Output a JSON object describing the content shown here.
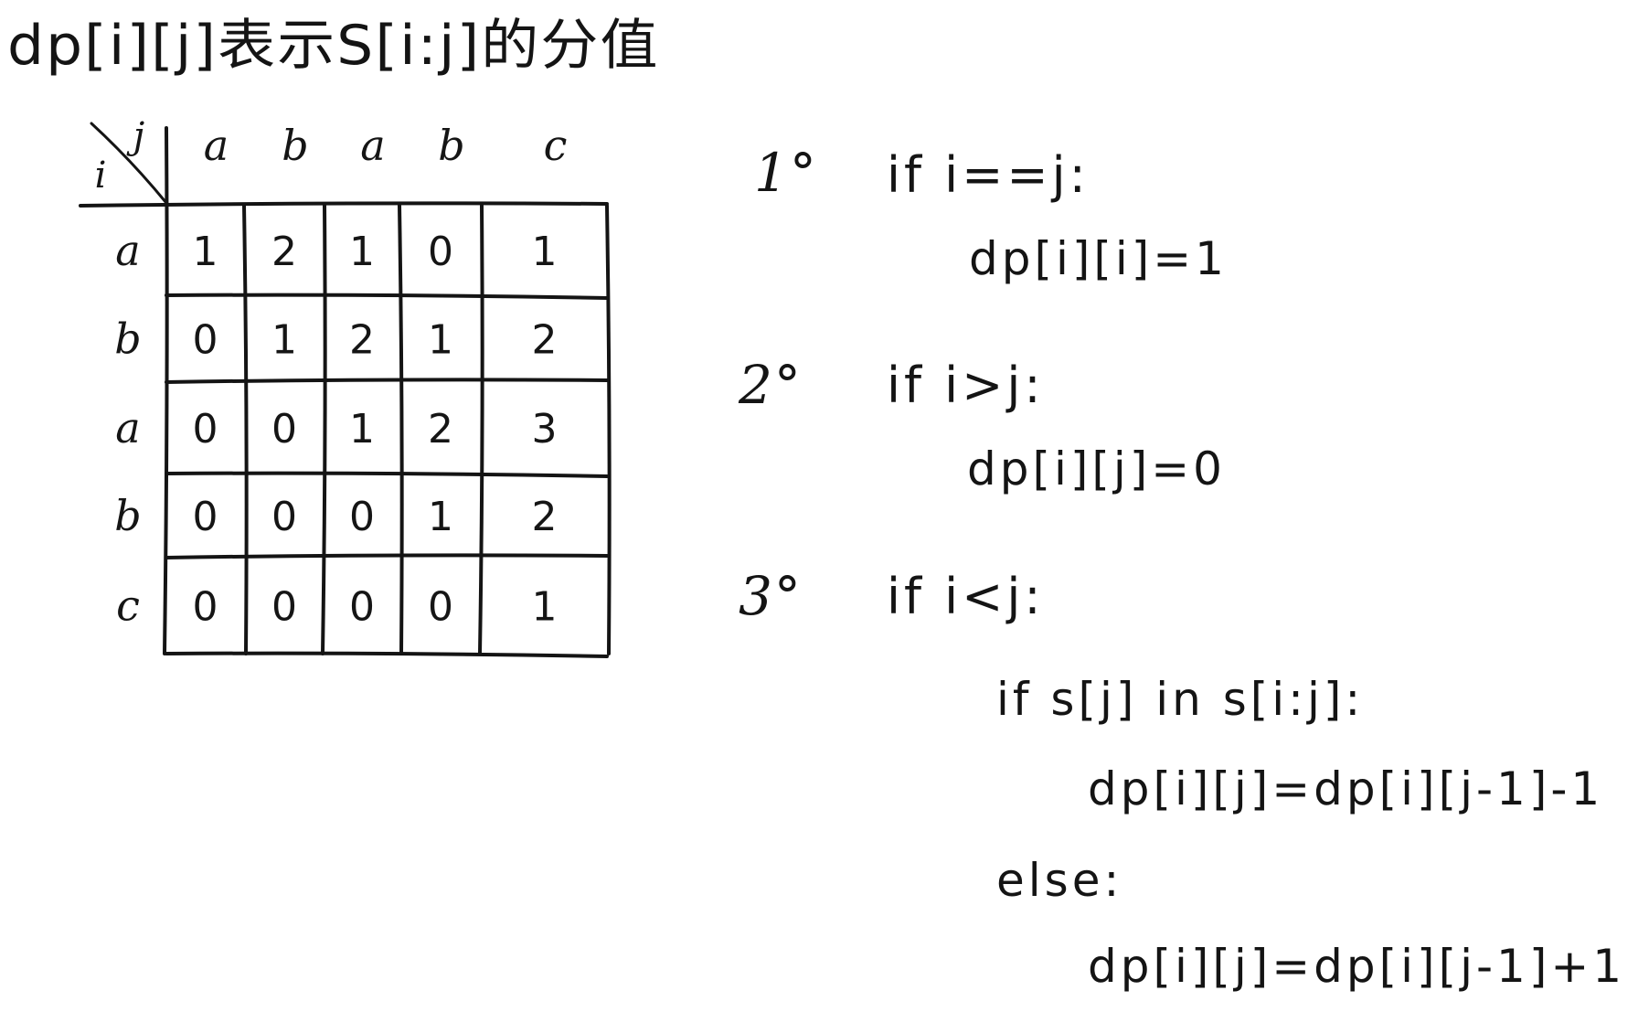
{
  "title": "dp[i][j]表示S[i:j]的分值",
  "table": {
    "corner_row_label": "i",
    "corner_col_label": "j",
    "col_headers": [
      "a",
      "b",
      "a",
      "b",
      "c"
    ],
    "row_headers": [
      "a",
      "b",
      "a",
      "b",
      "c"
    ],
    "rows": [
      [
        "1",
        "2",
        "1",
        "0",
        "1"
      ],
      [
        "0",
        "1",
        "2",
        "1",
        "2"
      ],
      [
        "0",
        "0",
        "1",
        "2",
        "3"
      ],
      [
        "0",
        "0",
        "0",
        "1",
        "2"
      ],
      [
        "0",
        "0",
        "0",
        "0",
        "1"
      ]
    ]
  },
  "rules": [
    {
      "number": "1°",
      "condition": "if  i==j:",
      "body": [
        "dp[i][i]=1"
      ]
    },
    {
      "number": "2°",
      "condition": "if  i>j:",
      "body": [
        "dp[i][j]=0"
      ]
    },
    {
      "number": "3°",
      "condition": "if  i<j:",
      "body": [
        "if  s[j]  in  s[i:j]:",
        "dp[i][j]=dp[i][j-1]-1",
        "else:",
        "dp[i][j]=dp[i][j-1]+1"
      ]
    }
  ]
}
